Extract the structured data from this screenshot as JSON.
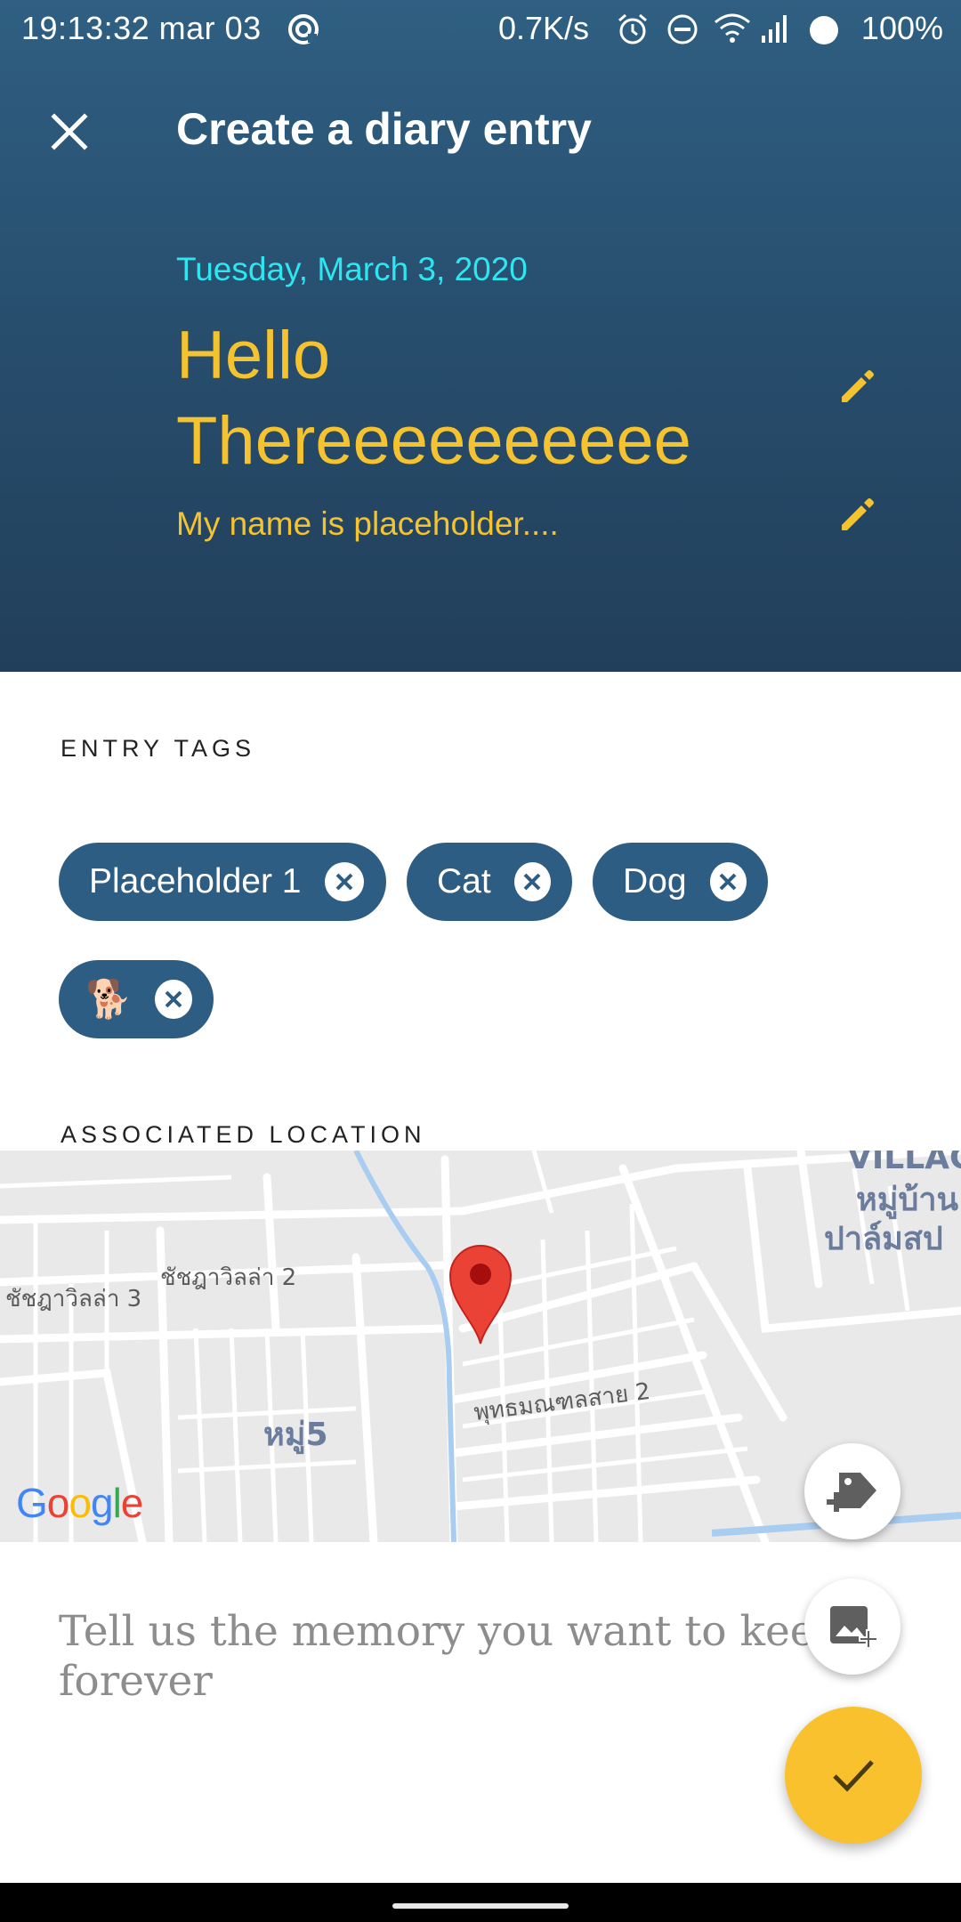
{
  "status_bar": {
    "time": "19:13:32 mar 03",
    "net_speed": "0.7K/s",
    "battery": "100%",
    "icons": [
      "sync-icon",
      "alarm-icon",
      "do-not-disturb-icon",
      "wifi-icon",
      "signal-icon",
      "battery-icon"
    ]
  },
  "app_bar": {
    "title": "Create a diary entry",
    "close_icon": "close-icon"
  },
  "entry": {
    "date": "Tuesday, March 3, 2020",
    "title": "Hello Thereeeeeeeeee",
    "subtitle": "My name is placeholder....",
    "edit_icon": "pencil-icon"
  },
  "tags": {
    "label": "ENTRY TAGS",
    "items": [
      {
        "label": "Placeholder 1"
      },
      {
        "label": "Cat"
      },
      {
        "label": "Dog"
      },
      {
        "label": "🐕"
      }
    ],
    "remove_icon": "close-circle-icon"
  },
  "location": {
    "label": "ASSOCIATED LOCATION",
    "map_labels": {
      "road_1": "ชัชฎาวิลล่า 2",
      "road_2": "ชัชฎาวิลล่า 3",
      "road_3": "พุทธมณฑลสาย 2",
      "area_1": "หมู่5",
      "area_2": "VILLAG",
      "area_3": "หมู่บ้าน",
      "area_4": "ปาล์มสป"
    },
    "attribution": "Google",
    "pin_icon": "map-pin-icon"
  },
  "memory": {
    "placeholder": "Tell us the memory you want to keep forever"
  },
  "fabs": {
    "add_tag_icon": "add-tag-icon",
    "add_image_icon": "add-image-icon",
    "confirm_icon": "check-icon"
  },
  "colors": {
    "header_top": "#2f5f82",
    "header_bottom": "#213f5a",
    "date": "#2de6f0",
    "title": "#f5c230",
    "chip": "#2d5d82",
    "confirm_fab": "#f9c12e"
  }
}
